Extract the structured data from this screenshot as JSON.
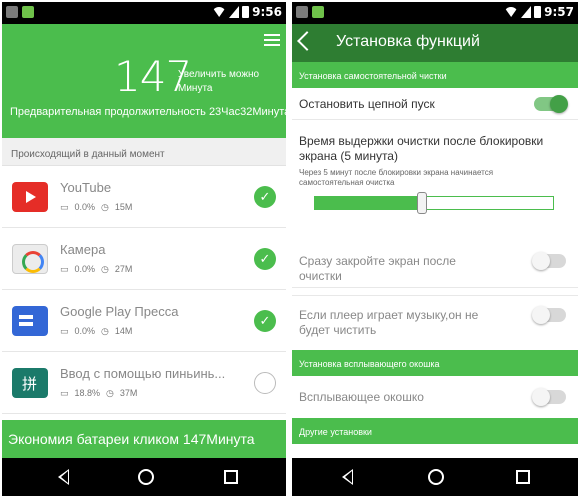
{
  "left": {
    "status": {
      "time": "9:56"
    },
    "header": {
      "saved_minutes": "147",
      "increase_label": "Увеличить можно Минута",
      "pre_duration": "Предварительная продолжительность 23Час32Минута"
    },
    "section_title": "Происходящий в данный момент",
    "apps": [
      {
        "name": "YouTube",
        "cpu": "0.0%",
        "mem": "15M",
        "selected": true
      },
      {
        "name": "Камера",
        "cpu": "0.0%",
        "mem": "27M",
        "selected": true
      },
      {
        "name": "Google Play Пресса",
        "cpu": "0.0%",
        "mem": "14M",
        "selected": true
      },
      {
        "name": "Ввод с помощью пиньинь...",
        "cpu": "18.8%",
        "mem": "37M",
        "selected": false
      }
    ],
    "footer_button": "Экономия батареи кликом 147Минута"
  },
  "right": {
    "status": {
      "time": "9:57"
    },
    "title": "Установка функций",
    "groups": {
      "self_clean": "Установка самостоятельной чистки",
      "popup": "Установка всплывающего окошка",
      "other": "Другие установки"
    },
    "settings": {
      "stop_chain": {
        "label": "Остановить цепной пуск",
        "on": true
      },
      "delay": {
        "label": "Время выдержки очистки после блокировки экрана (5 минута)",
        "note": "Через 5 минут после блокировки экрана начинается самостоятельная очистка",
        "slider_fraction": 0.45
      },
      "close_screen": {
        "label": "Сразу закройте экран после очистки",
        "on": false
      },
      "music": {
        "label": "Если плеер играет музыку,он не будет чистить",
        "on": false
      },
      "popup_window": {
        "label": "Всплывающее окошко",
        "on": false
      }
    }
  },
  "colors": {
    "green": "#4bbd4d",
    "dark_green": "#2e7d32",
    "check_green": "#4bbd4d"
  }
}
